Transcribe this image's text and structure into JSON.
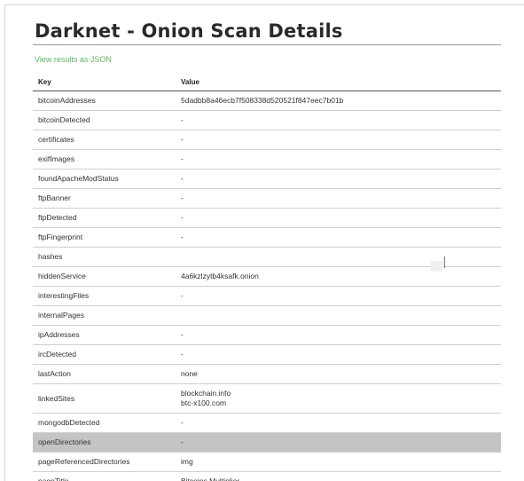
{
  "page": {
    "title": "Darknet - Onion Scan Details",
    "json_link": "View results as JSON"
  },
  "table": {
    "headers": {
      "key": "Key",
      "value": "Value"
    },
    "rows": [
      {
        "key": "bitcoinAddresses",
        "value": [
          "5dadbb8a46ecb7f508338d520521f847eec7b01b"
        ]
      },
      {
        "key": "bitcoinDetected",
        "value": [
          "-"
        ]
      },
      {
        "key": "certificates",
        "value": [
          "-"
        ]
      },
      {
        "key": "exifImages",
        "value": [
          "-"
        ]
      },
      {
        "key": "foundApacheModStatus",
        "value": [
          "-"
        ]
      },
      {
        "key": "ftpBanner",
        "value": [
          "-"
        ]
      },
      {
        "key": "ftpDetected",
        "value": [
          "-"
        ]
      },
      {
        "key": "ftpFingerprint",
        "value": [
          "-"
        ]
      },
      {
        "key": "hashes",
        "value": []
      },
      {
        "key": "hiddenService",
        "value": [
          "4a6kzlzytb4ksafk.onion"
        ]
      },
      {
        "key": "interestingFiles",
        "value": [
          "-"
        ]
      },
      {
        "key": "internalPages",
        "value": []
      },
      {
        "key": "ipAddresses",
        "value": [
          "-"
        ]
      },
      {
        "key": "ircDetected",
        "value": [
          "-"
        ]
      },
      {
        "key": "lastAction",
        "value": [
          "none"
        ]
      },
      {
        "key": "linkedSites",
        "value": [
          "blockchain.info",
          "btc-x100.com"
        ]
      },
      {
        "key": "mongodbDetected",
        "value": [
          "-"
        ]
      },
      {
        "key": "openDirectories",
        "value": [
          "-"
        ],
        "highlighted": true
      },
      {
        "key": "pageReferencedDirectories",
        "value": [
          "img"
        ]
      },
      {
        "key": "pageTitle",
        "value": [
          "Bitcoins Multiplier"
        ]
      }
    ]
  },
  "colors": {
    "link": "#5cb85c",
    "highlight_row": "#c4c4c4",
    "title": "#2a2a2a"
  }
}
